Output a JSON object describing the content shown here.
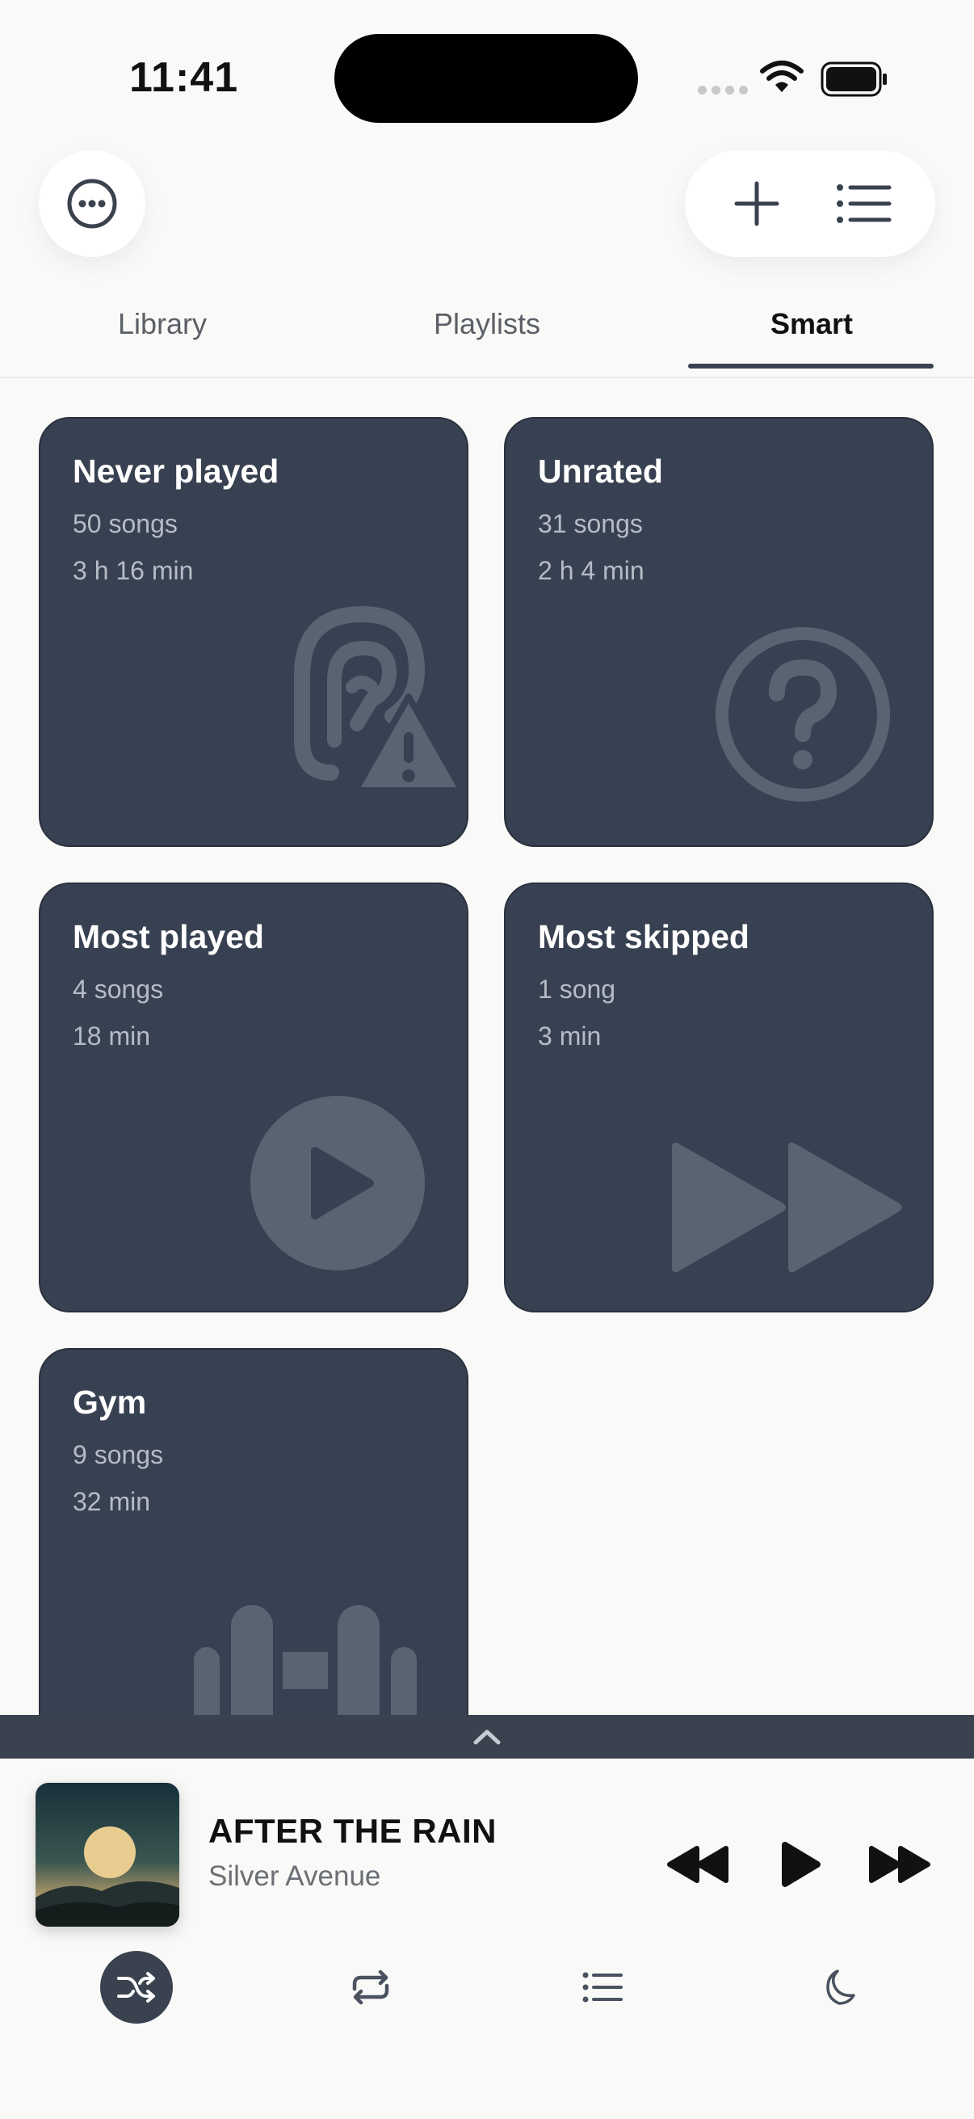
{
  "status_bar": {
    "time": "11:41"
  },
  "colors": {
    "card_bg": "#384151",
    "accent": "#3a4250",
    "page_bg": "#f9f9f8"
  },
  "header": {
    "menu_icon": "ellipsis-circle-icon",
    "add_icon": "plus-icon",
    "list_icon": "list-icon"
  },
  "tabs": [
    {
      "label": "Library",
      "active": false
    },
    {
      "label": "Playlists",
      "active": false
    },
    {
      "label": "Smart",
      "active": true
    }
  ],
  "smart_playlists": [
    {
      "title": "Never played",
      "count": "50 songs",
      "duration": "3 h 16 min",
      "icon": "ear-warning-icon"
    },
    {
      "title": "Unrated",
      "count": "31 songs",
      "duration": "2 h 4 min",
      "icon": "question-circle-icon"
    },
    {
      "title": "Most played",
      "count": "4 songs",
      "duration": "18 min",
      "icon": "play-circle-icon"
    },
    {
      "title": "Most skipped",
      "count": "1 song",
      "duration": "3 min",
      "icon": "fast-forward-icon"
    },
    {
      "title": "Gym",
      "count": "9 songs",
      "duration": "32 min",
      "icon": "dumbbell-icon"
    }
  ],
  "now_playing": {
    "title": "AFTER THE RAIN",
    "artist": "Silver Avenue",
    "controls": [
      "previous-icon",
      "play-icon",
      "next-icon"
    ],
    "options": [
      {
        "icon": "shuffle-icon",
        "active": true
      },
      {
        "icon": "repeat-icon",
        "active": false
      },
      {
        "icon": "queue-list-icon",
        "active": false
      },
      {
        "icon": "sleep-timer-moon-icon",
        "active": false
      }
    ]
  }
}
